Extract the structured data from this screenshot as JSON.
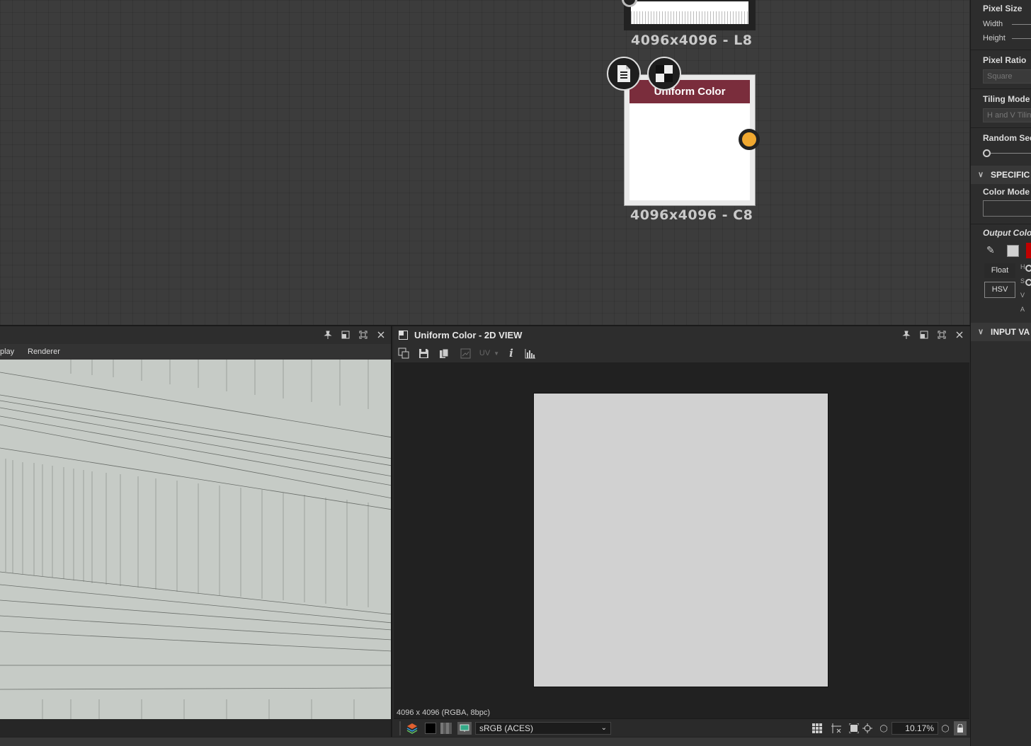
{
  "graph": {
    "top_node_label": "4096x4096 - L8",
    "node": {
      "title": "Uniform Color",
      "size_label": "4096x4096 - C8"
    }
  },
  "right_panel": {
    "pixel_size": "Pixel Size",
    "width": "Width",
    "height": "Height",
    "pixel_ratio": "Pixel Ratio",
    "pixel_ratio_value": "Square",
    "tiling_mode": "Tiling Mode",
    "tiling_mode_value": "H and V Tiling",
    "random_seed": "Random Seed",
    "specific_section": "SPECIFIC",
    "color_mode": "Color Mode",
    "output_color": "Output Color",
    "float_label": "Float",
    "hsv_label": "HSV",
    "h": "H",
    "s": "S",
    "v": "V",
    "a": "A",
    "input_section": "INPUT VA"
  },
  "panel3d": {
    "menu_display": "play",
    "menu_renderer": "Renderer"
  },
  "panel2d": {
    "title": "Uniform Color - 2D VIEW",
    "uv_label": "UV",
    "info": "4096 x 4096 (RGBA, 8bpc)",
    "colorspace": "sRGB (ACES)",
    "zoom": "10.17%"
  },
  "colors": {
    "node_header": "#7a2d3c",
    "port": "#f0a830",
    "canvas_fill": "#d1d1d1"
  }
}
